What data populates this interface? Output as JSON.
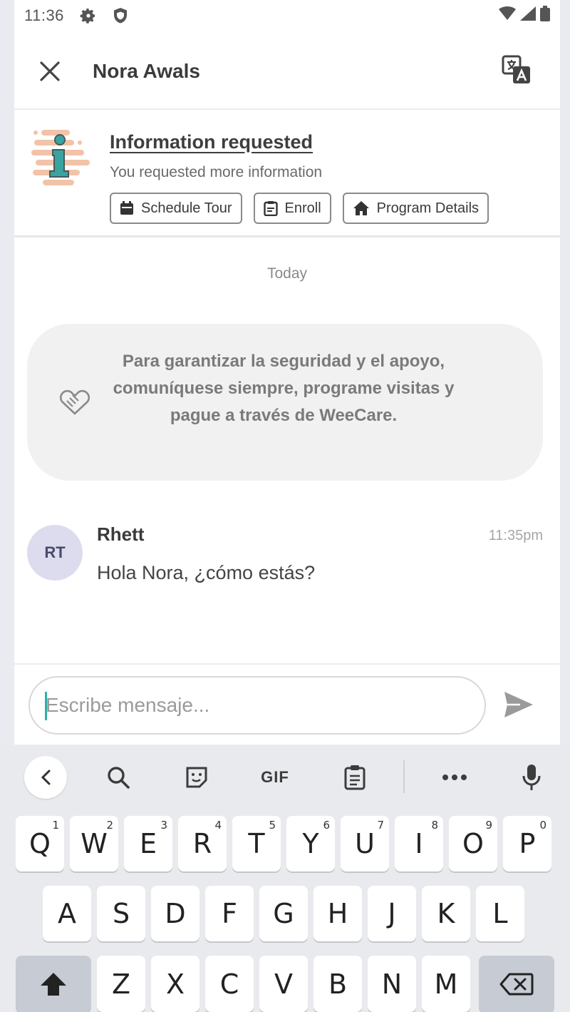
{
  "status_bar": {
    "time": "11:36"
  },
  "header": {
    "title": "Nora Awals"
  },
  "info_card": {
    "title": "Information requested",
    "subtitle": "You requested more information",
    "actions": [
      "Schedule Tour",
      "Enroll",
      "Program Details"
    ]
  },
  "chat": {
    "date_separator": "Today",
    "safety_notice": "Para garantizar la seguridad y el apoyo, comuníquese siempre, programe visitas y pague a través de WeeCare.",
    "messages": [
      {
        "initials": "RT",
        "sender": "Rhett",
        "time": "11:35pm",
        "text": "Hola Nora, ¿cómo estás?"
      }
    ]
  },
  "composer": {
    "placeholder": "Escribe mensaje..."
  },
  "keyboard": {
    "toolbar": {
      "gif_label": "GIF"
    },
    "row1": [
      {
        "key": "Q",
        "hint": "1"
      },
      {
        "key": "W",
        "hint": "2"
      },
      {
        "key": "E",
        "hint": "3"
      },
      {
        "key": "R",
        "hint": "4"
      },
      {
        "key": "T",
        "hint": "5"
      },
      {
        "key": "Y",
        "hint": "6"
      },
      {
        "key": "U",
        "hint": "7"
      },
      {
        "key": "I",
        "hint": "8"
      },
      {
        "key": "O",
        "hint": "9"
      },
      {
        "key": "P",
        "hint": "0"
      }
    ],
    "row2": [
      "A",
      "S",
      "D",
      "F",
      "G",
      "H",
      "J",
      "K",
      "L"
    ],
    "row3": [
      "Z",
      "X",
      "C",
      "V",
      "B",
      "N",
      "M"
    ]
  }
}
